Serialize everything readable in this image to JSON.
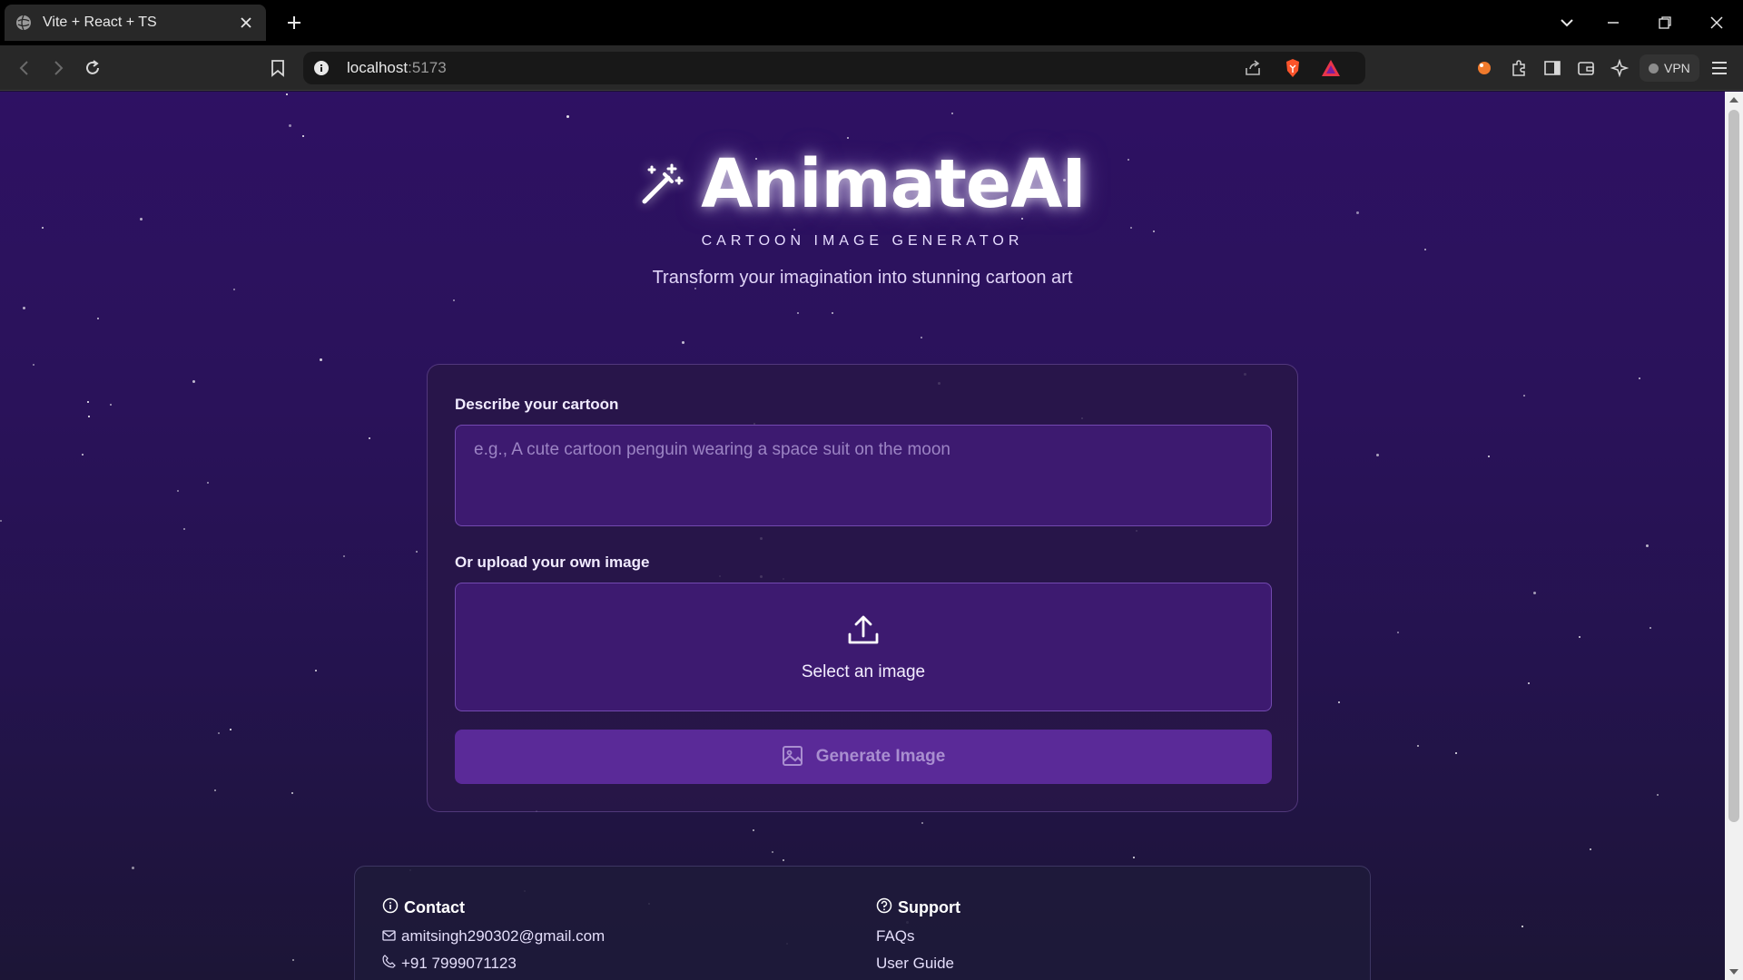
{
  "browser": {
    "tab_title": "Vite + React + TS",
    "url_host": "localhost",
    "url_port": ":5173",
    "vpn_label": "VPN"
  },
  "hero": {
    "title": "AnimateAI",
    "subtitle": "CARTOON IMAGE GENERATOR",
    "tagline": "Transform your imagination into stunning cartoon art"
  },
  "form": {
    "prompt_label": "Describe your cartoon",
    "prompt_placeholder": "e.g., A cute cartoon penguin wearing a space suit on the moon",
    "prompt_value": "",
    "upload_label": "Or upload your own image",
    "upload_button": "Select an image",
    "generate_button": "Generate Image"
  },
  "footer": {
    "contact_title": "Contact",
    "email": "amitsingh290302@gmail.com",
    "phone": "+91 7999071123",
    "support_title": "Support",
    "faqs": "FAQs",
    "user_guide": "User Guide"
  },
  "colors": {
    "accent": "#5a2a98",
    "background_top": "#2e1163",
    "background_bottom": "#1c1536",
    "field_bg": "#3d1a70"
  }
}
